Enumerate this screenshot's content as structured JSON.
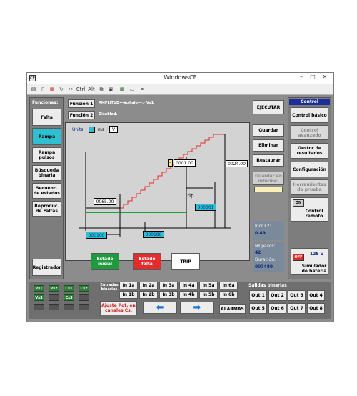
{
  "window": {
    "title": "WindowsCE",
    "minimize": "–",
    "maximize": "□",
    "close": "✕"
  },
  "toolbar": {
    "ctrl": "Ctrl",
    "alt": "Alt"
  },
  "functions": {
    "header": "Funciones:",
    "items": [
      {
        "label": "Falta",
        "active": false
      },
      {
        "label": "Rampa",
        "active": true
      },
      {
        "label": "Rampa pulsos",
        "active": false
      },
      {
        "label": "Búsqueda binaria",
        "active": false
      },
      {
        "label": "Secuenc. de estados",
        "active": false
      },
      {
        "label": "Reproduc. de Faltas",
        "active": false
      }
    ],
    "registrador": "Registrador"
  },
  "func1": {
    "button": "Función 1",
    "text": "AMPLITUD---Voltaje---> Vs1"
  },
  "func2": {
    "button": "Función 2",
    "text": "Disabled."
  },
  "plot": {
    "units_label": "Units:",
    "unit_ms": "ms",
    "unit_v": "V",
    "initial_value": "0065.00",
    "step_value": "0001.00",
    "final_value": "0024.00",
    "trip_label": "Trip",
    "time_a": "000100",
    "time_b": "000180",
    "time_trip": "000001"
  },
  "states": {
    "initial": {
      "label": "Estado inicial",
      "color": "#1f9a3e"
    },
    "fault": {
      "label": "Estado falta",
      "color": "#e52b2b"
    },
    "trip": {
      "label": "TRIP",
      "color": "#ffffff"
    }
  },
  "actions": {
    "ejecutar": "EJECUTAR",
    "guardar": "Guardar",
    "eliminar": "Eliminar",
    "restaurar": "Restaurar",
    "guardar_informe": "Guardar en informe:"
  },
  "info": {
    "incr_label": "Incr F2:",
    "incr_value": "0.49",
    "pasos_label": "Nº pasos:",
    "pasos_value": "42",
    "duracion_label": "Duración:",
    "duracion_value": "007480"
  },
  "control": {
    "header": "Control",
    "basico": "Control básico",
    "avanzado": "Control avanzado",
    "gestor": "Gestor de resultados",
    "configuracion": "Configuración",
    "herramientas": "Herramientas de prueba",
    "on_label": "ON",
    "remoto": "Control remoto",
    "off_label": "OFF",
    "battery_voltage": "125 V",
    "simulador": "Simulador de batería"
  },
  "binary_inputs": {
    "label": "Entradas binarias",
    "row1": [
      "In 1a",
      "In 2a",
      "In 3a",
      "In 4a",
      "In 5a",
      "In 6a"
    ],
    "row2": [
      "In 1b",
      "In 2b",
      "In 3b",
      "In 4b",
      "In 5b",
      "In 6b"
    ]
  },
  "binary_outputs": {
    "label": "Salidas binarias",
    "row1": [
      "Out 1",
      "Out 2",
      "Out 3",
      "Out 4"
    ],
    "row2": [
      "Out 5",
      "Out 6",
      "Out 7",
      "Out 8"
    ]
  },
  "channels": {
    "row1": [
      "Vs1",
      "Vs2",
      "Cs1",
      "Cs2"
    ],
    "row2": [
      "Vs3",
      "",
      "Cs3",
      ""
    ]
  },
  "ajuste": "Ajuste Pot. en canales Cs.",
  "alarmas": "ALARMAS",
  "nav": {
    "left": "⬅",
    "right": "➡"
  }
}
